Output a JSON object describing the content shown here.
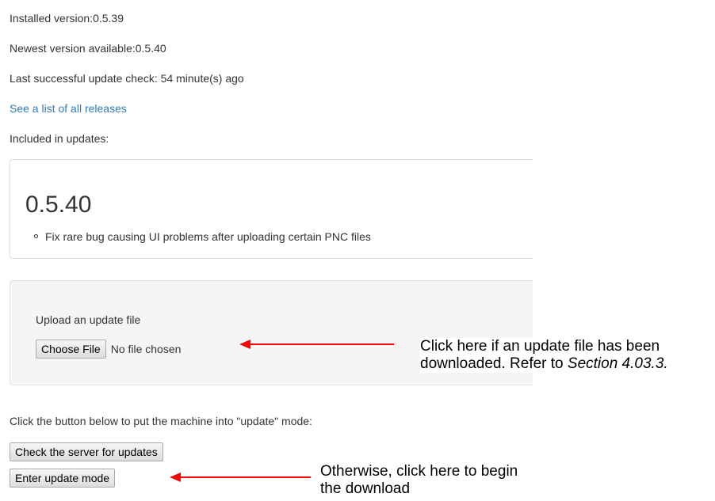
{
  "status": {
    "installed_label": "Installed version:",
    "installed_value": "0.5.39",
    "newest_label": "Newest version available:",
    "newest_value": "0.5.40",
    "last_check": "Last successful update check: 54 minute(s) ago"
  },
  "releases_link": "See a list of all releases",
  "included_label": "Included in updates:",
  "release": {
    "version": "0.5.40",
    "notes": [
      "Fix rare bug causing UI problems after uploading certain PNC files"
    ]
  },
  "upload": {
    "label": "Upload an update file",
    "choose_button": "Choose File",
    "file_status": "No file chosen"
  },
  "update_mode": {
    "instruction": "Click the button below to put the machine into \"update\" mode:",
    "check_button": "Check the server for updates",
    "enter_button": "Enter update mode"
  },
  "annotations": {
    "upload_hint_line1": "Click here if an update file has been",
    "upload_hint_line2_prefix": "downloaded. Refer to ",
    "upload_hint_section": "Section 4.03.3.",
    "enter_hint_line1": "Otherwise, click here to begin",
    "enter_hint_line2": "the download",
    "arrow_color": "#ff0000"
  }
}
